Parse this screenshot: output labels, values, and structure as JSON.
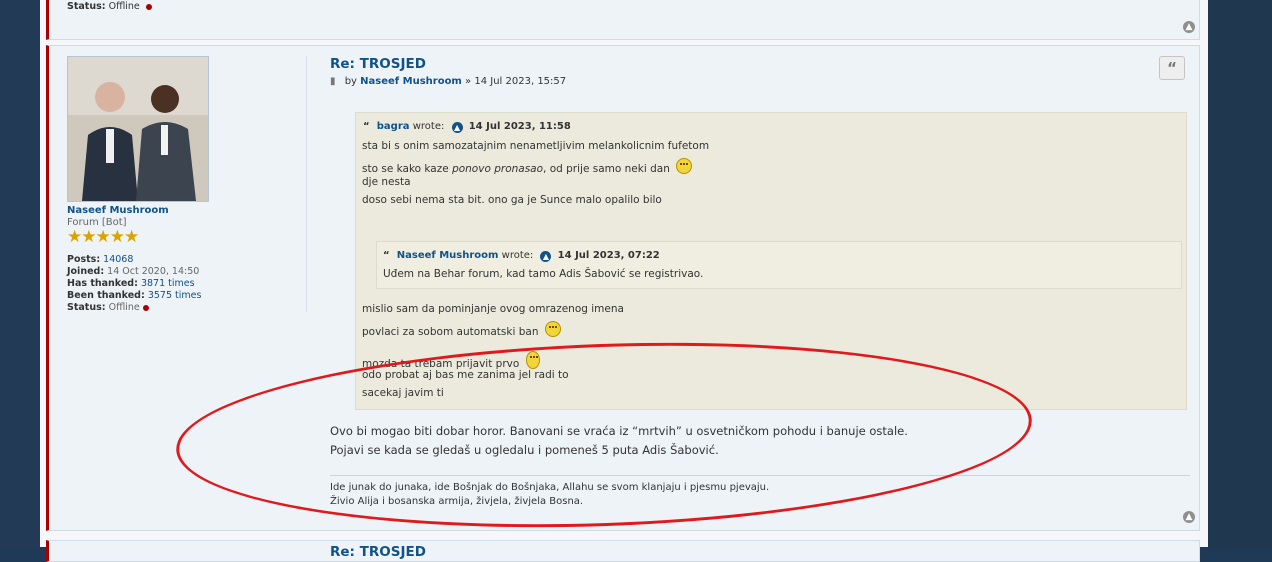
{
  "top_post": {
    "status_label": "Status:",
    "status_value": "Offline",
    "up_icon": "arrow-up-icon"
  },
  "profile": {
    "username": "Naseef Mushroom",
    "rank": "Forum [Bot]",
    "stars": "★★★★★",
    "posts_label": "Posts:",
    "posts_value": "14068",
    "joined_label": "Joined:",
    "joined_value": "14 Oct 2020, 14:50",
    "thanked_label": "Has thanked:",
    "thanked_value": "3871 times",
    "been_thanked_label": "Been thanked:",
    "been_thanked_value": "3575 times",
    "status_label": "Status:",
    "status_value": "Offline"
  },
  "post": {
    "title": "Re: TROSJED",
    "by": "by",
    "author": "Naseef Mushroom",
    "separator": "»",
    "date": "14 Jul 2023, 15:57",
    "quote_button_icon": "quote-icon",
    "quote": {
      "user": "bagra",
      "wrote": "wrote:",
      "date": "14 Jul 2023, 11:58",
      "lines": [
        "sta bi s onim samozatajnim nenametljivim melankolicnim fufetom",
        "sto se kako kaze",
        "ponovo pronasao",
        ", od prije samo neki dan",
        "dje nesta",
        "doso sebi nema sta bit. ono ga je Sunce malo opalilo bilo"
      ],
      "nested": {
        "user": "Naseef Mushroom",
        "wrote": "wrote:",
        "date": "14 Jul 2023, 07:22",
        "text": "Uđem na Behar forum, kad tamo Adis Šabović se registrivao."
      },
      "after_lines": [
        "mislio sam da pominjanje ovog omrazenog imena",
        "povlaci za sobom automatski ban",
        "mozda ta trebam prijavit prvo",
        "odo probat aj bas me zanima jel radi to",
        "sacekaj javim ti"
      ]
    },
    "body": [
      "Ovo bi mogao biti dobar horor. Banovani se vraća iz “mrtvih” u osvetničkom pohodu i banuje ostale.",
      "Pojavi se kada se gledaš u ogledalu i pomeneš 5 puta Adis Šabović."
    ],
    "signature": [
      "Ide junak do junaka, ide Bošnjak do Bošnjaka, Allahu se svom klanjaju i pjesmu pjevaju.",
      "Živio Alija i bosanska armija, živjela, živjela Bosna."
    ]
  },
  "next_post": {
    "title": "Re: TROSJED"
  },
  "colors": {
    "link": "#105289",
    "post_border": "#aa0000",
    "annotation": "#e0191c",
    "quote_bg": "#ebeadd"
  }
}
